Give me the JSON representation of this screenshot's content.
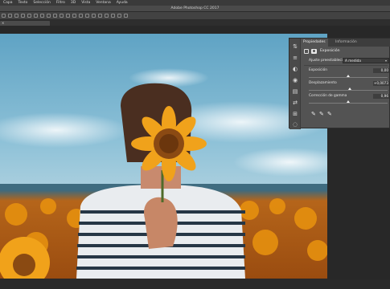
{
  "menu": {
    "items": [
      "Capa",
      "Texto",
      "Selección",
      "Filtro",
      "3D",
      "Vista",
      "Ventana",
      "Ayuda"
    ]
  },
  "window": {
    "title": "Adobe Photoshop CC 2017"
  },
  "document": {
    "close_label": "×"
  },
  "panel": {
    "tabs": [
      "Propiedades",
      "Información"
    ],
    "title": "Exposición",
    "preset_label": "Ajuste preestablecido:",
    "preset_value": "A medida",
    "params": [
      {
        "label": "Exposición",
        "value": "0,00",
        "slider": 0.5
      },
      {
        "label": "Desplazamiento",
        "value": "+0,0073",
        "slider": 0.52
      },
      {
        "label": "Corrección de gamma",
        "value": "0,96",
        "slider": 0.5
      }
    ],
    "strip_icons": [
      "history-icon",
      "brush-presets-icon",
      "adjustment-icon",
      "layers-icon",
      "channels-icon",
      "paths-icon",
      "properties-icon",
      "character-icon"
    ]
  },
  "colors": {
    "menubar": "#3a3a3a",
    "panel": "#535353",
    "canvas_bg": "#282828",
    "sky": "#7fb6cf",
    "sunflower": "#e8920e"
  }
}
